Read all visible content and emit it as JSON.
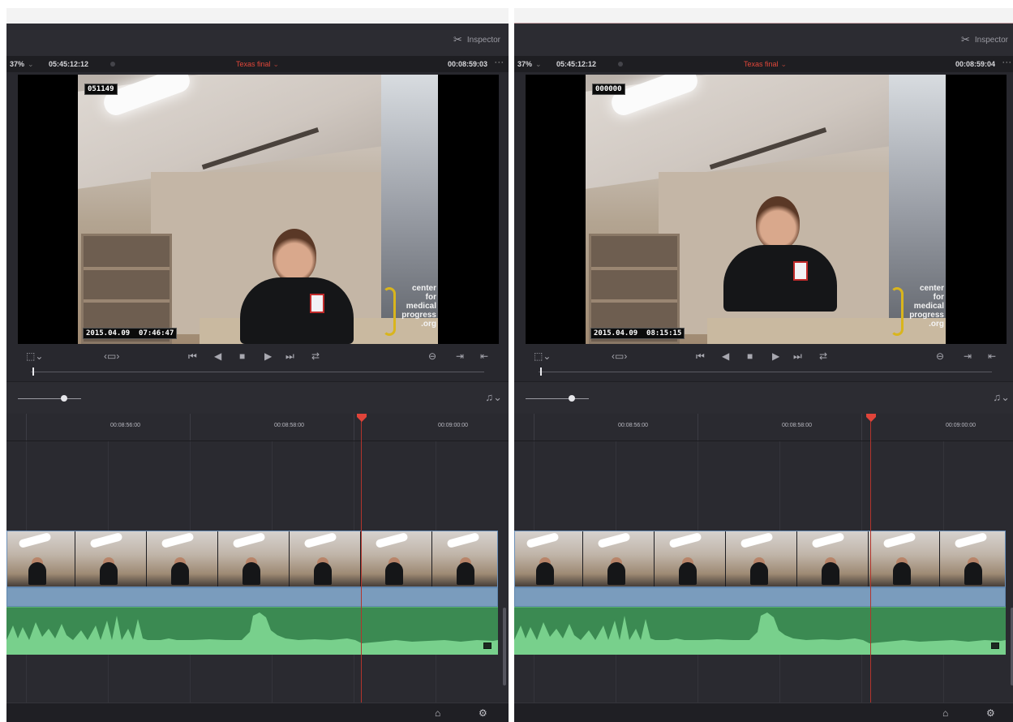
{
  "panels": [
    {
      "inspector_label": "Inspector",
      "zoom": "37%",
      "source_timecode": "05:45:12:12",
      "timeline_name": "Texas final",
      "record_timecode": "00:08:59:03",
      "burn_counter": "051149",
      "burn_date": "2015.04.09  07:46:47",
      "watermark": "center\nfor\nmedical\nprogress\n.org",
      "ruler_labels": [
        "00:08:56:00",
        "00:08:58:00",
        "00:09:00:00"
      ]
    },
    {
      "inspector_label": "Inspector",
      "zoom": "37%",
      "source_timecode": "05:45:12:12",
      "timeline_name": "Texas final",
      "record_timecode": "00:08:59:04",
      "burn_counter": "000000",
      "burn_date": "2015.04.09  08:15:15",
      "watermark": "center\nfor\nmedical\nprogress\n.org",
      "ruler_labels": [
        "00:08:56:00",
        "00:08:58:00",
        "00:09:00:00"
      ]
    }
  ],
  "icons": {
    "inspector": "inspector-icon",
    "viewer_options": "viewer-options-icon",
    "transport": [
      "jump-to-start-icon",
      "play-reverse-icon",
      "stop-icon",
      "play-icon",
      "jump-to-end-icon",
      "loop-icon"
    ],
    "audio": "audio-meter-icon",
    "footer": [
      "home-icon",
      "settings-icon"
    ]
  },
  "colors": {
    "playhead": "#e0443a",
    "timeline_name": "#e2473a",
    "video_clip": "#7a9cbd",
    "audio_clip": "#3b8a52"
  }
}
